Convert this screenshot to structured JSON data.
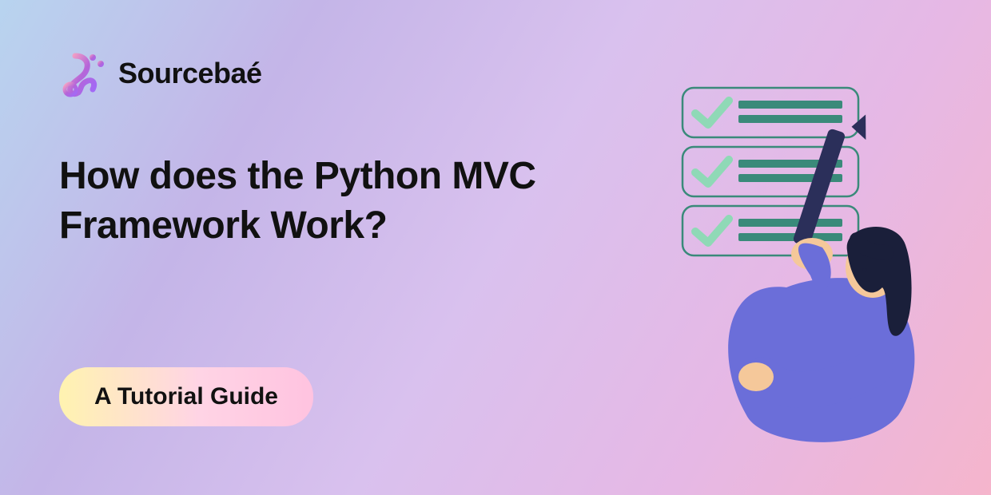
{
  "brand": {
    "name": "Sourcebaé"
  },
  "hero": {
    "headline": "How does the Python MVC Framework Work?"
  },
  "badge": {
    "label": "A Tutorial Guide"
  },
  "colors": {
    "text": "#111111",
    "badge_gradient": [
      "#fff3b0",
      "#ffd4e5",
      "#ffc3e0"
    ],
    "bg_gradient": [
      "#b8d4ef",
      "#c4b5e8",
      "#d9c1ee",
      "#e6b8e5",
      "#f5b5cc"
    ],
    "illustration_body": "#6b6ed9",
    "illustration_hair": "#1a1f3a",
    "illustration_skin": "#f5c89a",
    "illustration_check": "#8fd9b6",
    "illustration_line": "#3a8a7a",
    "illustration_pen": "#2b2f5a"
  }
}
